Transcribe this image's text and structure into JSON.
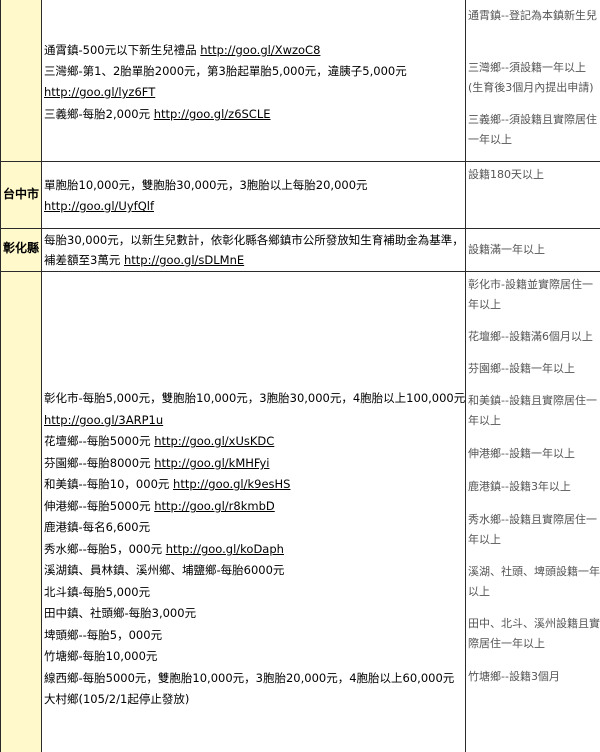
{
  "rows": [
    {
      "region": "",
      "lines": [
        {
          "text": "通霄鎮-500元以下新生兒禮品 ",
          "link": "http://goo.gl/XwzoC8"
        },
        {
          "text": "三灣鄉-第1、2胎單胎2000元，第3胎起單胎5,000元，違胰子5,000元",
          "link": ""
        },
        {
          "text": " ",
          "link": "http://goo.gl/lyz6FT"
        },
        {
          "text": "三義鄉-每胎2,000元 ",
          "link": "http://goo.gl/z6SCLE"
        }
      ],
      "conditions": [
        "通霄鎮--登記為本鎮新生兒",
        "三灣鄉--須設籍一年以上(生育後3個月內提出申請)",
        "三義鄉--須設籍且實際居住一年以上"
      ]
    },
    {
      "region": "台中市",
      "lines": [
        {
          "text": "單胞胎10,000元，雙胞胎30,000元，3胞胎以上每胎20,000元",
          "link": ""
        },
        {
          "text": "",
          "link": "http://goo.gl/UyfQlf"
        }
      ],
      "conditions": [
        "設籍180天以上"
      ]
    },
    {
      "region": "彰化縣",
      "lines": [
        {
          "text": "每胎30,000元，以新生兒數計，依彰化縣各鄉鎮市公所發放知生育補助金為基準，",
          "link": ""
        },
        {
          "text": "補差額至3萬元 ",
          "link": "http://goo.gl/sDLMnE"
        }
      ],
      "conditions": [
        "設籍滿一年以上"
      ]
    },
    {
      "region": "",
      "lines": [
        {
          "text": "彰化市-每胎5,000元，雙胞胎10,000元，3胞胎30,000元，4胞胎以上100,000元",
          "link": ""
        },
        {
          "text": "",
          "link": "http://goo.gl/3ARP1u"
        },
        {
          "text": "花壇鄉--每胎5000元 ",
          "link": "http://goo.gl/xUsKDC"
        },
        {
          "text": "芬園鄉--每胎8000元 ",
          "link": "http://goo.gl/kMHFyi"
        },
        {
          "text": "和美鎮--每胎10，000元 ",
          "link": "http://goo.gl/k9esHS"
        },
        {
          "text": "伸港鄉--每胎5000元 ",
          "link": "http://goo.gl/r8kmbD"
        },
        {
          "text": "鹿港鎮-每名6,600元",
          "link": ""
        },
        {
          "text": "秀水鄉--每胎5，000元 ",
          "link": "http://goo.gl/koDaph"
        },
        {
          "text": "溪湖鎮、員林鎮、溪州鄉、埔鹽鄉-每胎6000元",
          "link": ""
        },
        {
          "text": "北斗鎮-每胎5,000元",
          "link": ""
        },
        {
          "text": "田中鎮、社頭鄉-每胎3,000元",
          "link": ""
        },
        {
          "text": "埤頭鄉--每胎5，000元",
          "link": ""
        },
        {
          "text": "竹塘鄉-每胎10,000元",
          "link": ""
        },
        {
          "text": "線西鄉-每胎5000元，雙胞胎10,000元，3胞胎20,000元，4胞胎以上60,000元",
          "link": ""
        },
        {
          "text": "大村鄉(105/2/1起停止發放)",
          "link": ""
        }
      ],
      "conditions": [
        "彰化市-設籍並實際居住一年以上",
        "花壇鄉--設籍滿6個月以上",
        "芬園鄉--設籍一年以上",
        "和美鎮--設籍且實際居住一年以上",
        "伸港鄉--設籍一年以上",
        "鹿港鎮--設籍3年以上",
        "秀水鄉--設籍且實際居住一年以上",
        "溪湖、社頭、埤頭設籍一年以上",
        "田中、北斗、溪州設籍且實際居住一年以上",
        "竹塘鄉--設籍3個月"
      ]
    }
  ]
}
